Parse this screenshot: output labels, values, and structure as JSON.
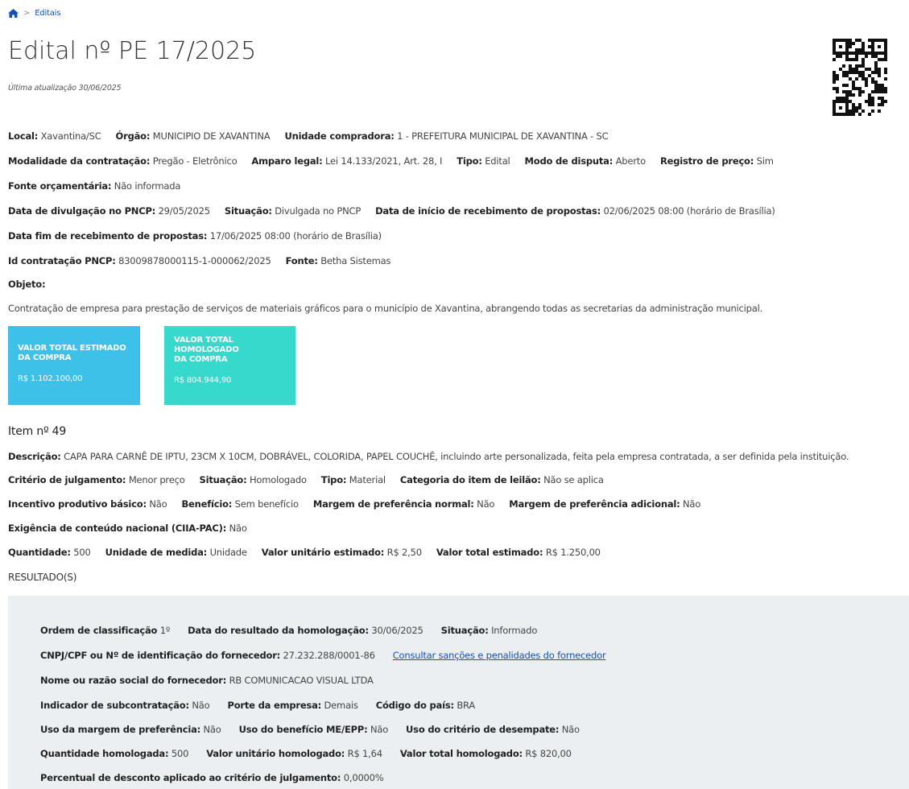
{
  "breadcrumb": {
    "home_icon": "home-icon",
    "separator": ">",
    "current": "Editais"
  },
  "page": {
    "title": "Edital nº PE 17/2025",
    "updated": "Última atualização 30/06/2025"
  },
  "info": {
    "row1": [
      {
        "label": "Local:",
        "value": "Xavantina/SC"
      },
      {
        "label": "Órgão:",
        "value": "MUNICIPIO DE XAVANTINA"
      },
      {
        "label": "Unidade compradora:",
        "value": "1 - PREFEITURA MUNICIPAL DE XAVANTINA - SC"
      }
    ],
    "row2": [
      {
        "label": "Modalidade da contratação:",
        "value": "Pregão - Eletrônico"
      },
      {
        "label": "Amparo legal:",
        "value": "Lei 14.133/2021, Art. 28, I"
      },
      {
        "label": "Tipo:",
        "value": "Edital"
      },
      {
        "label": "Modo de disputa:",
        "value": "Aberto"
      },
      {
        "label": "Registro de preço:",
        "value": "Sim"
      }
    ],
    "row3": [
      {
        "label": "Fonte orçamentária:",
        "value": "Não informada"
      }
    ],
    "row4": [
      {
        "label": "Data de divulgação no PNCP:",
        "value": "29/05/2025"
      },
      {
        "label": "Situação:",
        "value": "Divulgada no PNCP"
      },
      {
        "label": "Data de início de recebimento de propostas:",
        "value": "02/06/2025 08:00 (horário de Brasília)"
      }
    ],
    "row5": [
      {
        "label": "Data fim de recebimento de propostas:",
        "value": "17/06/2025 08:00 (horário de Brasília)"
      }
    ],
    "row6": [
      {
        "label": "Id contratação PNCP:",
        "value": "83009878000115-1-000062/2025"
      },
      {
        "label": "Fonte:",
        "value": "Betha Sistemas"
      }
    ],
    "objeto_label": "Objeto:",
    "objeto_text": "Contratação de empresa para prestação de serviços de materiais gráficos para o município de Xavantina, abrangendo todas as secretarias da administração municipal."
  },
  "cards": [
    {
      "title": "VALOR TOTAL ESTIMADO DA COMPRA",
      "value": "R$ 1.102.100,00",
      "color": "#3ec1e8"
    },
    {
      "title": "VALOR TOTAL HOMOLOGADO DA COMPRA",
      "value": "R$ 804.944,90",
      "color": "#36d9cc"
    }
  ],
  "item": {
    "title": "Item nº 49",
    "descricao_label": "Descrição:",
    "descricao": "CAPA PARA CARNÊ DE IPTU, 23CM X 10CM, DOBRÁVEL, COLORIDA, PAPEL COUCHÊ, incluindo arte personalizada, feita pela empresa contratada, a ser definida pela instituição.",
    "row1": [
      {
        "label": "Critério de julgamento:",
        "value": "Menor preço"
      },
      {
        "label": "Situação:",
        "value": "Homologado"
      },
      {
        "label": "Tipo:",
        "value": "Material"
      },
      {
        "label": "Categoria do item de leilão:",
        "value": "Não se aplica"
      }
    ],
    "row2": [
      {
        "label": "Incentivo produtivo básico:",
        "value": "Não"
      },
      {
        "label": "Benefício:",
        "value": "Sem benefício"
      },
      {
        "label": "Margem de preferência normal:",
        "value": "Não"
      },
      {
        "label": "Margem de preferência adicional:",
        "value": "Não"
      }
    ],
    "row3": [
      {
        "label": "Exigência de conteúdo nacional (CIIA-PAC):",
        "value": "Não"
      }
    ],
    "row4": [
      {
        "label": "Quantidade:",
        "value": "500"
      },
      {
        "label": "Unidade de medida:",
        "value": "Unidade"
      },
      {
        "label": "Valor unitário estimado:",
        "value": "R$ 2,50"
      },
      {
        "label": "Valor total estimado:",
        "value": "R$ 1.250,00"
      }
    ]
  },
  "resultado": {
    "heading": "RESULTADO(S)",
    "row1": [
      {
        "label": "Ordem de classificação",
        "value": "1º"
      },
      {
        "label": "Data do resultado da homologação:",
        "value": "30/06/2025"
      },
      {
        "label": "Situação:",
        "value": "Informado"
      }
    ],
    "row2_label": "CNPJ/CPF ou Nº de identificação do fornecedor:",
    "row2_value": "27.232.288/0001-86",
    "row2_link": "Consultar sanções e penalidades do fornecedor",
    "row3": [
      {
        "label": "Nome ou razão social do fornecedor:",
        "value": "RB COMUNICACAO VISUAL LTDA"
      }
    ],
    "row4": [
      {
        "label": "Indicador de subcontratação:",
        "value": "Não"
      },
      {
        "label": "Porte da empresa:",
        "value": "Demais"
      },
      {
        "label": "Código do país:",
        "value": "BRA"
      }
    ],
    "row5": [
      {
        "label": "Uso da margem de preferência:",
        "value": "Não"
      },
      {
        "label": "Uso do benefício ME/EPP:",
        "value": "Não"
      },
      {
        "label": "Uso do critério de desempate:",
        "value": "Não"
      }
    ],
    "row6": [
      {
        "label": "Quantidade homologada:",
        "value": "500"
      },
      {
        "label": "Valor unitário homologado:",
        "value": "R$ 1,64"
      },
      {
        "label": "Valor total homologado:",
        "value": "R$ 820,00"
      }
    ],
    "row7": [
      {
        "label": "Percentual de desconto aplicado ao critério de julgamento:",
        "value": "0,0000%"
      }
    ]
  }
}
